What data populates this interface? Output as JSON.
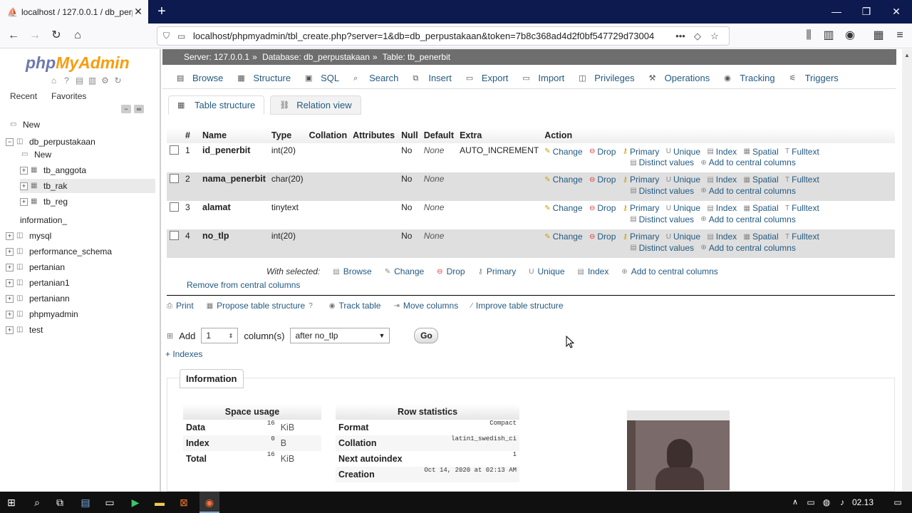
{
  "browser": {
    "tab_title": "localhost / 127.0.0.1 / db_perpu",
    "url": "localhost/phpmyadmin/tbl_create.php?server=1&db=db_perpustakaan&token=7b8c368ad4d2f0bf547729d73004",
    "time": "02.13"
  },
  "sidebar": {
    "logo_php": "php",
    "logo_my": "MyAdmin",
    "recent": "Recent",
    "favorites": "Favorites",
    "tree": [
      {
        "label": "New",
        "level": 1
      },
      {
        "label": "db_perpustakaan",
        "level": 0
      },
      {
        "label": "New",
        "level": 2
      },
      {
        "label": "tb_anggota",
        "level": 2
      },
      {
        "label": "tb_rak",
        "level": 2
      },
      {
        "label": "tb_reg",
        "level": 2
      },
      {
        "label": "information_",
        "level": 1
      },
      {
        "label": "mysql",
        "level": 0
      },
      {
        "label": "performance_schema",
        "level": 0
      },
      {
        "label": "pertanian",
        "level": 0
      },
      {
        "label": "pertanian1",
        "level": 0
      },
      {
        "label": "pertaniann",
        "level": 0
      },
      {
        "label": "phpmyadmin",
        "level": 0
      },
      {
        "label": "test",
        "level": 0
      }
    ]
  },
  "breadcrumb": {
    "server": "Server: 127.0.0.1",
    "database": "Database: db_perpustakaan",
    "table": "Table: tb_penerbit"
  },
  "menu_tabs": [
    "Browse",
    "Structure",
    "SQL",
    "Search",
    "Insert",
    "Export",
    "Import",
    "Privileges",
    "Operations",
    "Tracking",
    "Triggers"
  ],
  "sub_tabs": [
    "Table structure",
    "Relation view"
  ],
  "table": {
    "headers": [
      "#",
      "Name",
      "Type",
      "Collation",
      "Attributes",
      "Null",
      "Default",
      "Extra",
      "Action"
    ],
    "rows": [
      {
        "num": "1",
        "name": "id_penerbit",
        "type": "int(20)",
        "collation": "",
        "attributes": "",
        "null": "No",
        "default": "None",
        "extra": "AUTO_INCREMENT"
      },
      {
        "num": "2",
        "name": "nama_penerbit",
        "type": "char(20)",
        "collation": "",
        "attributes": "",
        "null": "No",
        "default": "None",
        "extra": ""
      },
      {
        "num": "3",
        "name": "alamat",
        "type": "tinytext",
        "collation": "",
        "attributes": "",
        "null": "No",
        "default": "None",
        "extra": ""
      },
      {
        "num": "4",
        "name": "no_tlp",
        "type": "int(20)",
        "collation": "",
        "attributes": "",
        "null": "No",
        "default": "None",
        "extra": ""
      }
    ],
    "actions": {
      "change": "Change",
      "drop": "Drop",
      "primary": "Primary",
      "unique": "Unique",
      "index": "Index",
      "spatial": "Spatial",
      "fulltext": "Fulltext",
      "distinct": "Distinct values",
      "central": "Add to central columns"
    }
  },
  "with_selected": {
    "label": "With selected:",
    "actions": [
      "Browse",
      "Change",
      "Drop",
      "Primary",
      "Unique",
      "Index",
      "Add to central columns"
    ],
    "remove_central": "Remove from central columns"
  },
  "links": {
    "print": "Print",
    "propose": "Propose table structure",
    "track": "Track table",
    "move": "Move columns",
    "improve": "Improve table structure"
  },
  "add": {
    "label": "Add",
    "count": "1",
    "columns": "column(s)",
    "position": "after no_tlp",
    "go": "Go"
  },
  "indexes": "+ Indexes",
  "information": {
    "tab": "Information",
    "space_usage": {
      "title": "Space usage",
      "rows": [
        {
          "k": "Data",
          "v": "16",
          "u": "KiB"
        },
        {
          "k": "Index",
          "v": "0",
          "u": "B"
        },
        {
          "k": "Total",
          "v": "16",
          "u": "KiB"
        }
      ]
    },
    "row_statistics": {
      "title": "Row statistics",
      "rows": [
        {
          "k": "Format",
          "v": "Compact"
        },
        {
          "k": "Collation",
          "v": "latin1_swedish_ci"
        },
        {
          "k": "Next autoindex",
          "v": "1"
        },
        {
          "k": "Creation",
          "v": "Oct 14, 2020 at 02:13 AM"
        }
      ]
    }
  }
}
